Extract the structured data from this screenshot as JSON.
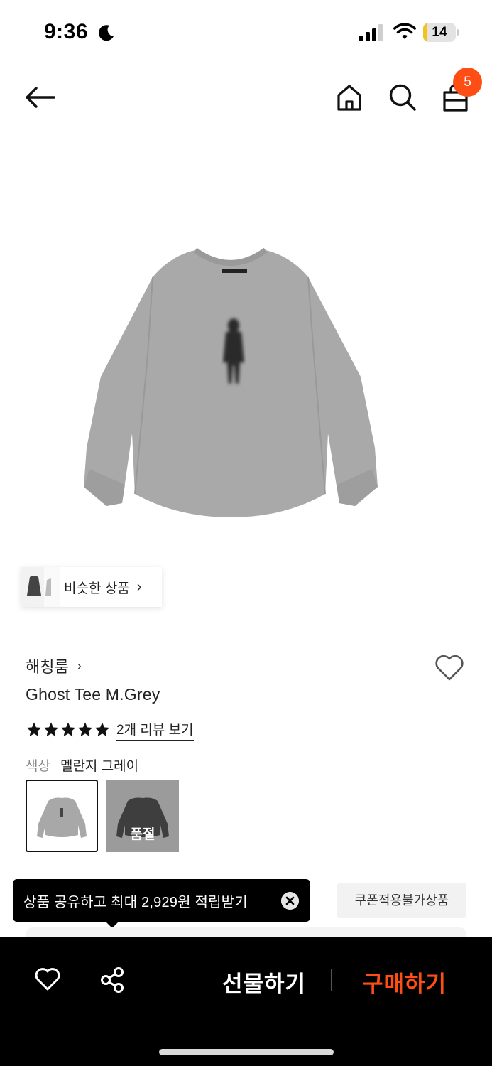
{
  "status_bar": {
    "time": "9:36",
    "battery_level": "14",
    "battery_fraction": 0.14
  },
  "nav": {
    "cart_count": "5"
  },
  "similar": {
    "label": "비슷한 상품",
    "chevron": "›"
  },
  "product": {
    "brand": "해칭룸",
    "brand_chevron": "›",
    "title": "Ghost Tee M.Grey",
    "rating_stars": 5,
    "review_link": "2개 리뷰 보기",
    "color_label": "색상",
    "color_value": "멜란지 그레이",
    "swatches": [
      {
        "name": "멜란지 그레이",
        "selected": true
      },
      {
        "name": "charcoal",
        "status": "품절"
      }
    ]
  },
  "tooltip": {
    "text": "상품 공유하고 최대 2,929원 적립받기"
  },
  "coupon": {
    "label": "쿠폰적용불가상품"
  },
  "bottom_bar": {
    "gift_label": "선물하기",
    "buy_label": "구매하기"
  },
  "colors": {
    "accent": "#ff4e15",
    "battery": "#f2c318",
    "bottom_bar_bg": "#000000"
  },
  "icons": [
    "moon-icon",
    "signal-icon",
    "wifi-icon",
    "battery-icon",
    "back-arrow-icon",
    "home-icon",
    "search-icon",
    "cart-icon",
    "heart-icon",
    "star-icon",
    "close-icon",
    "share-icon"
  ]
}
